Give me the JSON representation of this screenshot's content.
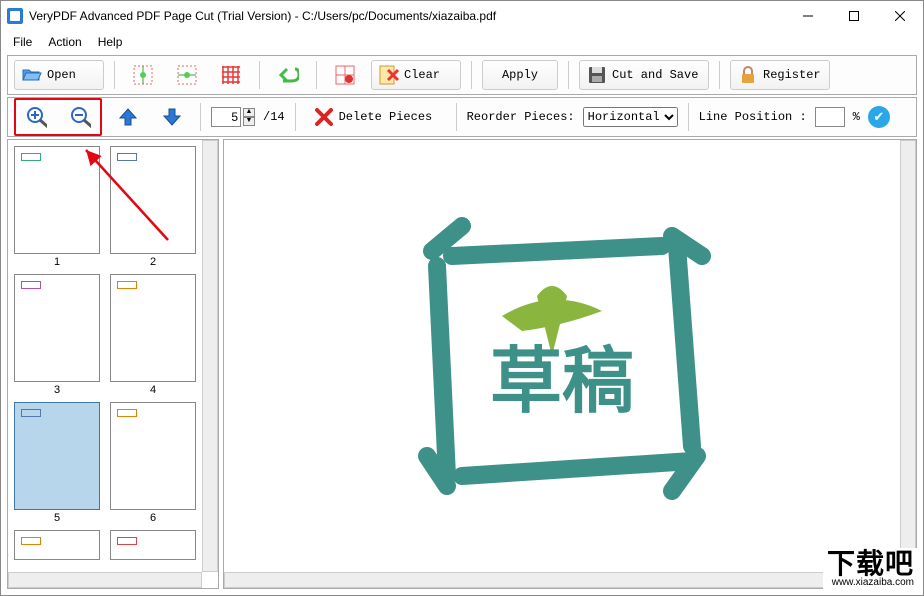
{
  "window": {
    "title": "VeryPDF Advanced PDF Page Cut (Trial Version) - C:/Users/pc/Documents/xiazaiba.pdf"
  },
  "menu": {
    "file": "File",
    "action": "Action",
    "help": "Help"
  },
  "toolbar": {
    "open": "Open",
    "clear": "Clear",
    "apply": "Apply",
    "cut_and_save": "Cut and Save",
    "register": "Register",
    "delete_pieces": "Delete Pieces",
    "reorder_label": "Reorder Pieces:",
    "reorder_value": "Horizontal",
    "line_position_label": "Line Position :",
    "line_position_value": "",
    "percent": "%",
    "page_current": "5",
    "page_total": "/14"
  },
  "thumbs": {
    "pages": [
      "1",
      "2",
      "3",
      "4",
      "5",
      "6",
      "",
      ""
    ]
  },
  "watermark": {
    "brand": "下载吧",
    "url": "www.xiazaiba.com"
  }
}
